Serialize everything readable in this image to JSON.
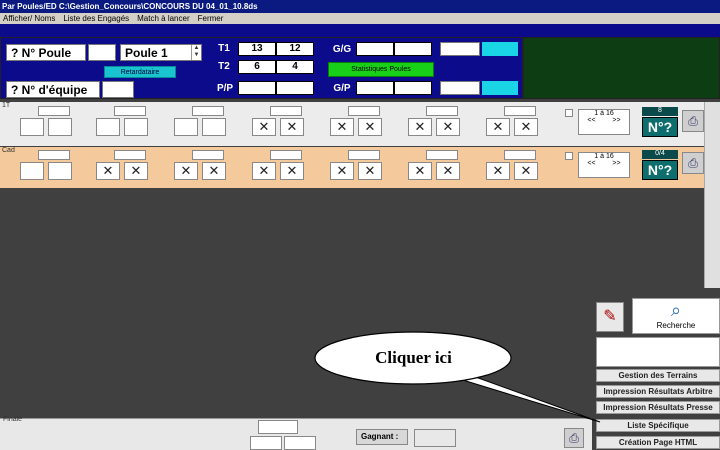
{
  "window": {
    "title": "Par Poules/ED C:\\Gestion_Concours\\CONCOURS DU 04_01_10.8ds"
  },
  "menu": [
    "Afficher/ Noms",
    "Liste des Engagés",
    "Match à lancer",
    "Fermer"
  ],
  "panel": {
    "poule_label": "? N° Poule",
    "poule_select": "Poule 1",
    "retardataire_button": "Retardataire",
    "equipe_label": "? N° d'équipe",
    "t1_label": "T1",
    "t1_a": "13",
    "t1_b": "12",
    "t2_label": "T2",
    "t2_a": "6",
    "t2_b": "4",
    "pp_label": "P/P",
    "gg_label": "G/G",
    "gp_label": "G/P",
    "stats_button": "Statistiques Poules"
  },
  "row1": {
    "label": "1T",
    "range": "1 à 16",
    "prev": "<<",
    "next": ">>",
    "counter": "8",
    "nq": "N°?"
  },
  "row2": {
    "label": "Cad",
    "range": "1 à 16",
    "prev": "<<",
    "next": ">>",
    "counter": "0/4",
    "nq": "N°?"
  },
  "side": {
    "recherche": "Recherche",
    "buttons": [
      "Gestion des Terrains",
      "Impression Résultats Arbitre",
      "Impression Résultats Presse",
      "Liste Spécifique",
      "Création Page HTML"
    ]
  },
  "finale": {
    "label": "Finale",
    "gagnant_label": "Gagnant :"
  },
  "callout": {
    "text": "Cliquer ici"
  },
  "colors": {
    "panel_blue": "#0b0b8c",
    "green_text": "#3ad13a",
    "row2_orange": "#f4c99b"
  }
}
